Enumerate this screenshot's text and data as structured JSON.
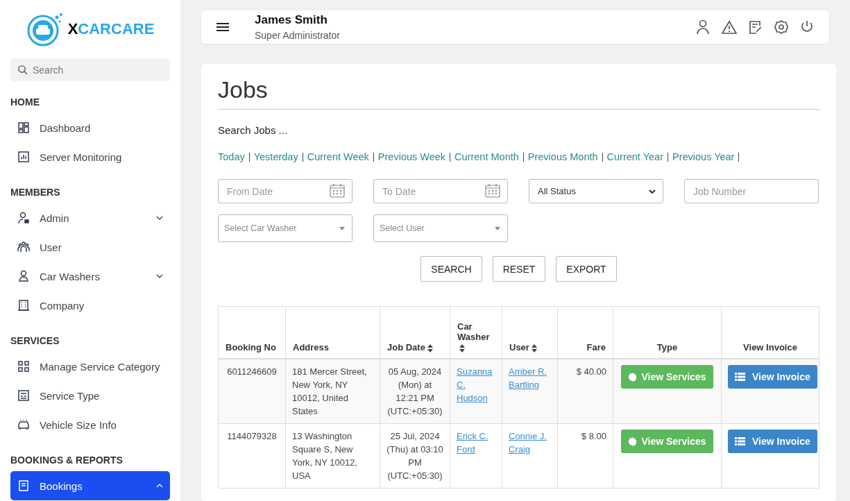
{
  "logo": {
    "prefix": "X",
    "name": "CARCARE"
  },
  "sidebar": {
    "search": {
      "placeholder": "Search"
    },
    "sections": [
      {
        "title": "HOME",
        "items": [
          {
            "label": "Dashboard",
            "expandable": false,
            "selected": false
          },
          {
            "label": "Server Monitoring",
            "expandable": false,
            "selected": false
          }
        ]
      },
      {
        "title": "MEMBERS",
        "items": [
          {
            "label": "Admin",
            "expandable": true,
            "selected": false
          },
          {
            "label": "User",
            "expandable": false,
            "selected": false
          },
          {
            "label": "Car Washers",
            "expandable": true,
            "selected": false
          },
          {
            "label": "Company",
            "expandable": false,
            "selected": false
          }
        ]
      },
      {
        "title": "SERVICES",
        "items": [
          {
            "label": "Manage Service Category",
            "expandable": false,
            "selected": false
          },
          {
            "label": "Service Type",
            "expandable": false,
            "selected": false
          },
          {
            "label": "Vehicle Size Info",
            "expandable": false,
            "selected": false
          }
        ]
      },
      {
        "title": "BOOKINGS & REPORTS",
        "items": [
          {
            "label": "Bookings",
            "expandable": true,
            "selected": true
          }
        ]
      }
    ]
  },
  "header": {
    "user_name": "James Smith",
    "role": "Super Administrator"
  },
  "page": {
    "title": "Jobs",
    "search_heading": "Search Jobs ...",
    "date_links": [
      "Today",
      "Yesterday",
      "Current Week",
      "Previous Week",
      "Current Month",
      "Previous Month",
      "Current Year",
      "Previous Year"
    ],
    "filters": [
      {
        "kind": "date",
        "placeholder": "From Date"
      },
      {
        "kind": "date",
        "placeholder": "To Date"
      },
      {
        "kind": "select",
        "value": "All Status"
      },
      {
        "kind": "text",
        "placeholder": "Job Number"
      },
      {
        "kind": "combo",
        "placeholder": "Select Car Washer"
      },
      {
        "kind": "combo",
        "placeholder": "Select User"
      }
    ],
    "buttons": [
      "SEARCH",
      "RESET",
      "EXPORT"
    ]
  },
  "table": {
    "columns": [
      {
        "label": "Booking No",
        "sortable": false
      },
      {
        "label": "Address",
        "sortable": false
      },
      {
        "label": "Job Date",
        "sortable": true
      },
      {
        "label": "Car Washer",
        "sortable": true
      },
      {
        "label": "User",
        "sortable": true
      },
      {
        "label": "Fare",
        "sortable": false
      },
      {
        "label": "Type",
        "sortable": false
      },
      {
        "label": "View Invoice",
        "sortable": false
      }
    ],
    "rows": [
      {
        "booking_no": "6011246609",
        "address": "181 Mercer Street, New York, NY 10012, United States",
        "job_date": "05 Aug, 2024 (Mon) at 12:21 PM (UTC:+05:30)",
        "car_washer": "Suzanna C. Hudson",
        "user": "Amber R. Bartling",
        "fare": "$ 40.00",
        "type_button": "View Services",
        "invoice_button": "View Invoice"
      },
      {
        "booking_no": "1144079328",
        "address": "13 Washington Square S, New York, NY 10012, USA",
        "job_date": "25 Jul, 2024 (Thu) at 03:10 PM (UTC:+05:30)",
        "car_washer": "Erick C. Ford",
        "user": "Connie J. Craig",
        "fare": "$ 8.00",
        "type_button": "View Services",
        "invoice_button": "View Invoice"
      }
    ]
  }
}
